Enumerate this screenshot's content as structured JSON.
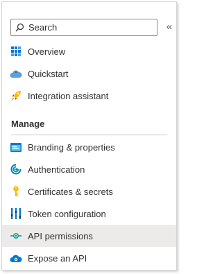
{
  "search": {
    "placeholder": "Search"
  },
  "collapse_glyph": "«",
  "nav": {
    "top_items": [
      {
        "label": "Overview",
        "icon": "overview-grid-icon"
      },
      {
        "label": "Quickstart",
        "icon": "quickstart-cloud-icon"
      },
      {
        "label": "Integration assistant",
        "icon": "rocket-icon"
      }
    ],
    "section_title": "Manage",
    "manage_items": [
      {
        "label": "Branding & properties",
        "icon": "branding-icon"
      },
      {
        "label": "Authentication",
        "icon": "authentication-icon"
      },
      {
        "label": "Certificates & secrets",
        "icon": "key-icon"
      },
      {
        "label": "Token configuration",
        "icon": "token-bars-icon"
      },
      {
        "label": "API permissions",
        "icon": "api-permissions-icon",
        "selected": true
      },
      {
        "label": "Expose an API",
        "icon": "expose-api-cloud-icon"
      }
    ]
  },
  "colors": {
    "selected_bg": "#edebe9",
    "accent": "#0078d4",
    "text": "#323130"
  }
}
